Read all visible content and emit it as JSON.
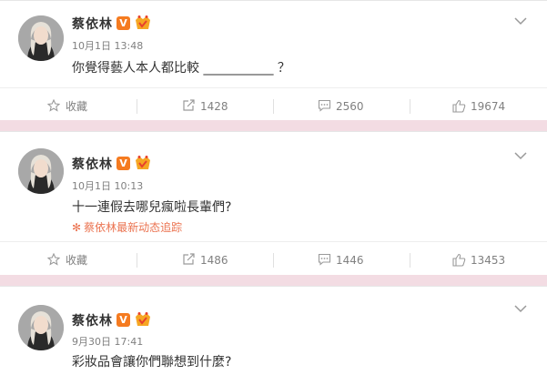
{
  "colors": {
    "background": "#f3dce3",
    "accent": "#eb7350",
    "verified": "#f57b20"
  },
  "posts": [
    {
      "username": "蔡依林",
      "verified_badge": "V",
      "timestamp": "10月1日 13:48",
      "content": "你覺得藝人本人都比較 ___________ ？",
      "source": "",
      "actions": {
        "favorite": "收藏",
        "repost": "1428",
        "comment": "2560",
        "like": "19674"
      }
    },
    {
      "username": "蔡依林",
      "verified_badge": "V",
      "timestamp": "10月1日 10:13",
      "content": "十一連假去哪兒瘋啦長輩們?",
      "source": "蔡依林最新动态追踪",
      "actions": {
        "favorite": "收藏",
        "repost": "1486",
        "comment": "1446",
        "like": "13453"
      }
    },
    {
      "username": "蔡依林",
      "verified_badge": "V",
      "timestamp": "9月30日 17:41",
      "content": "彩妝品會讓你們聯想到什麼?",
      "source": ""
    }
  ]
}
